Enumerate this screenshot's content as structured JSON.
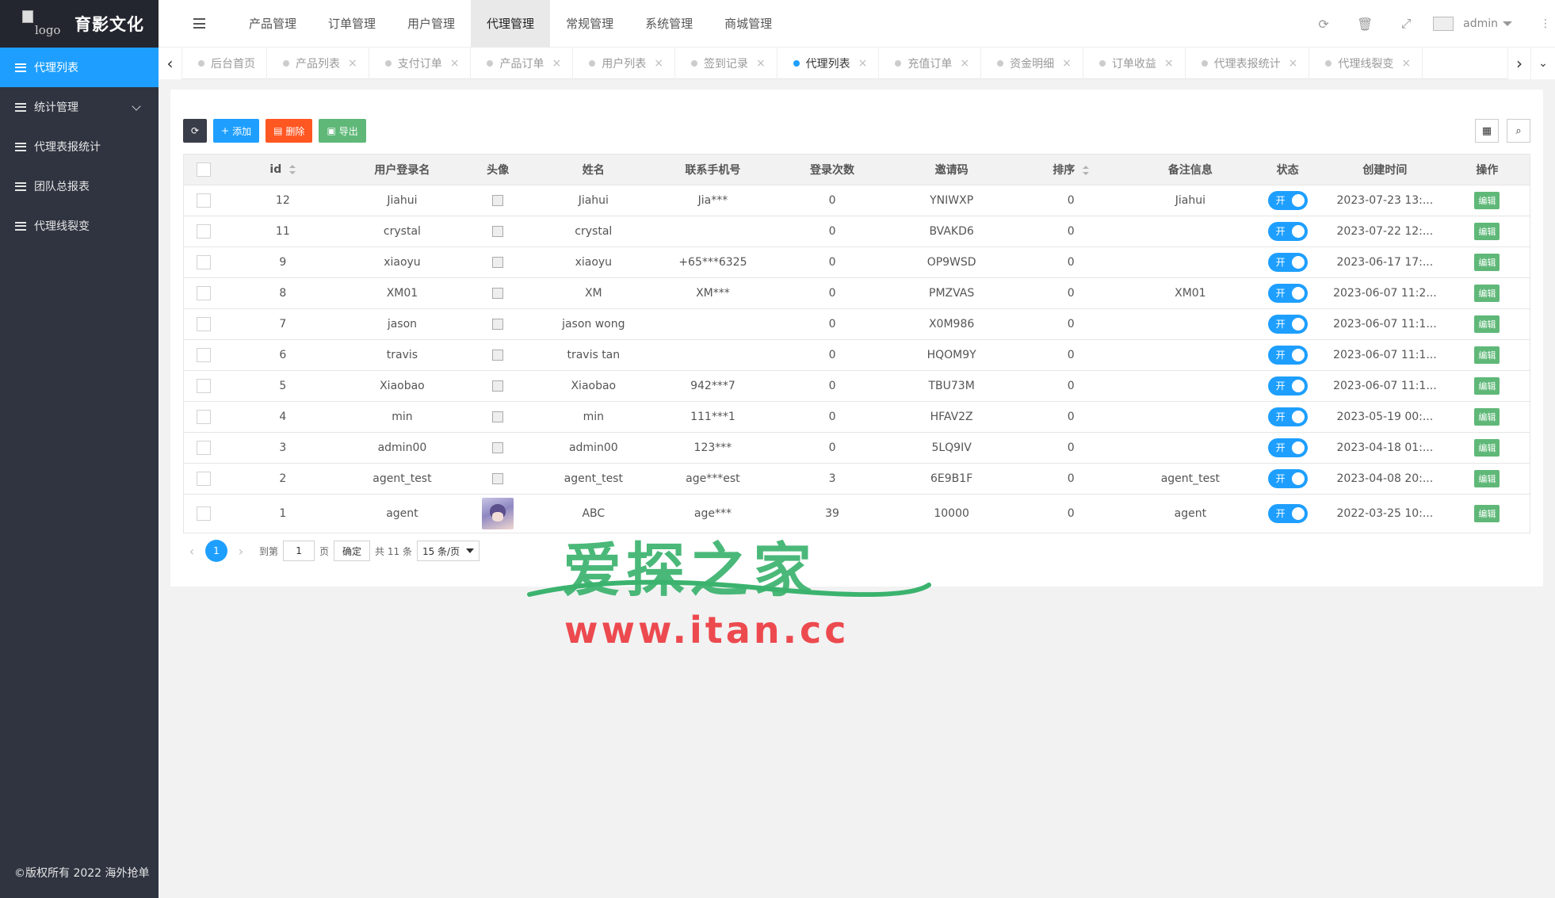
{
  "brand": {
    "logo_alt": "logo",
    "title": "育影文化"
  },
  "sidebar": {
    "items": [
      {
        "label": "代理列表",
        "active": true,
        "has_caret": false
      },
      {
        "label": "统计管理",
        "active": false,
        "has_caret": true
      },
      {
        "label": "代理表报统计",
        "active": false,
        "has_caret": false
      },
      {
        "label": "团队总报表",
        "active": false,
        "has_caret": false
      },
      {
        "label": "代理线裂变",
        "active": false,
        "has_caret": false
      }
    ],
    "copyright": "©版权所有 2022 海外抢单"
  },
  "header": {
    "nav": [
      {
        "label": "产品管理",
        "active": false
      },
      {
        "label": "订单管理",
        "active": false
      },
      {
        "label": "用户管理",
        "active": false
      },
      {
        "label": "代理管理",
        "active": true
      },
      {
        "label": "常规管理",
        "active": false
      },
      {
        "label": "系统管理",
        "active": false
      },
      {
        "label": "商城管理",
        "active": false
      }
    ],
    "user_name": "admin",
    "icons": [
      "refresh-icon",
      "trash-icon",
      "fullscreen-icon"
    ]
  },
  "tabs": [
    {
      "label": "后台首页",
      "active": false,
      "closable": false
    },
    {
      "label": "产品列表",
      "active": false,
      "closable": true
    },
    {
      "label": "支付订单",
      "active": false,
      "closable": true
    },
    {
      "label": "产品订单",
      "active": false,
      "closable": true
    },
    {
      "label": "用户列表",
      "active": false,
      "closable": true
    },
    {
      "label": "签到记录",
      "active": false,
      "closable": true
    },
    {
      "label": "代理列表",
      "active": true,
      "closable": true
    },
    {
      "label": "充值订单",
      "active": false,
      "closable": true
    },
    {
      "label": "资金明细",
      "active": false,
      "closable": true
    },
    {
      "label": "订单收益",
      "active": false,
      "closable": true
    },
    {
      "label": "代理表报统计",
      "active": false,
      "closable": true
    },
    {
      "label": "代理线裂变",
      "active": false,
      "closable": true
    }
  ],
  "toolbar": {
    "add": "添加",
    "delete": "删除",
    "export": "导出"
  },
  "table": {
    "headers": [
      "id",
      "用户登录名",
      "头像",
      "姓名",
      "联系手机号",
      "登录次数",
      "邀请码",
      "排序",
      "备注信息",
      "状态",
      "创建时间",
      "操作"
    ],
    "switch_label": "开",
    "edit_label": "编辑",
    "rows": [
      {
        "id": "12",
        "login": "Jiahui",
        "name": "Jiahui",
        "phone": "Jia***",
        "count": "0",
        "code": "YNIWXP",
        "sort": "0",
        "note": "Jiahui",
        "created": "2023-07-23 13:..."
      },
      {
        "id": "11",
        "login": "crystal",
        "name": "crystal",
        "phone": "",
        "count": "0",
        "code": "BVAKD6",
        "sort": "0",
        "note": "",
        "created": "2023-07-22 12:..."
      },
      {
        "id": "9",
        "login": "xiaoyu",
        "name": "xiaoyu",
        "phone": "+65***6325",
        "count": "0",
        "code": "OP9WSD",
        "sort": "0",
        "note": "",
        "created": "2023-06-17 17:..."
      },
      {
        "id": "8",
        "login": "XM01",
        "name": "XM",
        "phone": "XM***",
        "count": "0",
        "code": "PMZVAS",
        "sort": "0",
        "note": "XM01",
        "created": "2023-06-07 11:2..."
      },
      {
        "id": "7",
        "login": "jason",
        "name": "jason wong",
        "phone": "",
        "count": "0",
        "code": "X0M986",
        "sort": "0",
        "note": "",
        "created": "2023-06-07 11:1..."
      },
      {
        "id": "6",
        "login": "travis",
        "name": "travis tan",
        "phone": "",
        "count": "0",
        "code": "HQOM9Y",
        "sort": "0",
        "note": "",
        "created": "2023-06-07 11:1..."
      },
      {
        "id": "5",
        "login": "Xiaobao",
        "name": "Xiaobao",
        "phone": "942***7",
        "count": "0",
        "code": "TBU73M",
        "sort": "0",
        "note": "",
        "created": "2023-06-07 11:1..."
      },
      {
        "id": "4",
        "login": "min",
        "name": "min",
        "phone": "111***1",
        "count": "0",
        "code": "HFAV2Z",
        "sort": "0",
        "note": "",
        "created": "2023-05-19 00:..."
      },
      {
        "id": "3",
        "login": "admin00",
        "name": "admin00",
        "phone": "123***",
        "count": "0",
        "code": "5LQ9IV",
        "sort": "0",
        "note": "",
        "created": "2023-04-18 01:..."
      },
      {
        "id": "2",
        "login": "agent_test",
        "name": "agent_test",
        "phone": "age***est",
        "count": "3",
        "code": "6E9B1F",
        "sort": "0",
        "note": "agent_test",
        "created": "2023-04-08 20:..."
      },
      {
        "id": "1",
        "login": "agent",
        "name": "ABC",
        "phone": "age***",
        "count": "39",
        "code": "10000",
        "sort": "0",
        "note": "agent",
        "created": "2022-03-25 10:...",
        "has_avatar": true
      }
    ]
  },
  "pager": {
    "current": "1",
    "goto_label": "到第",
    "goto_value": "1",
    "page_unit": "页",
    "confirm": "确定",
    "total": "共 11 条",
    "page_size": "15 条/页"
  },
  "watermark": {
    "cn": "爱探之家",
    "url": "www.itan.cc"
  },
  "colors": {
    "primary": "#1e9fff",
    "sidebar": "#2f3440",
    "danger": "#ff5722",
    "success": "#5fb878"
  }
}
